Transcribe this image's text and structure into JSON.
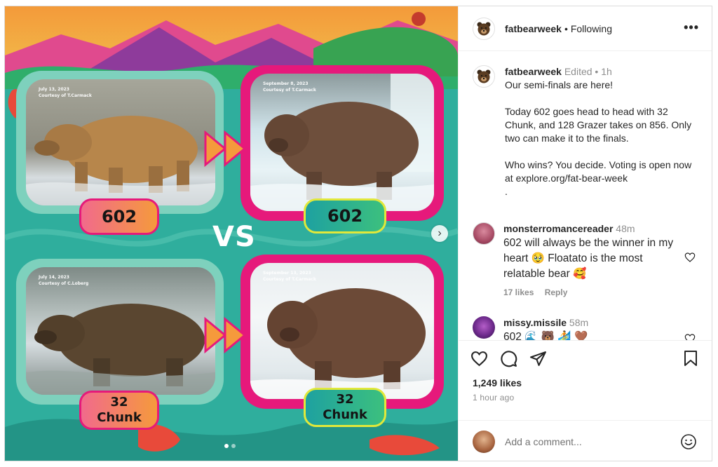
{
  "post": {
    "username": "fatbearweek",
    "follow_status": "Following",
    "more_label": "•••"
  },
  "caption": {
    "username": "fatbearweek",
    "edited": "Edited",
    "time": "1h",
    "lines": [
      "Our semi-finals are here!",
      "",
      "Today 602 goes head to head with 32 Chunk, and 128 Grazer takes on 856. Only two can make it to the finals.",
      "",
      "Who wins? You decide. Voting is open now at explore.org/fat-bear-week",
      "."
    ]
  },
  "comments": [
    {
      "username": "monsterromancereader",
      "time": "48m",
      "text": "602 will always be the winner in my heart 🥹 Floatato is the most relatable bear 🥰",
      "likes": "17 likes",
      "reply": "Reply"
    },
    {
      "username": "missy.missile",
      "time": "58m",
      "text": "602 🌊 🐻 🏄 🤎"
    }
  ],
  "media": {
    "vs_text": "VS",
    "panels": [
      {
        "caption": "July 13, 2023\nCourtesy of T.Carmack",
        "label": "602"
      },
      {
        "caption": "September 8, 2023\nCourtesy of T.Carmack",
        "label": "602"
      },
      {
        "caption": "July 14, 2023\nCourtesy of C.Loberg",
        "label": "32\nChunk"
      },
      {
        "caption": "September 13, 2023\nCourtesy of T.Carmack",
        "label": "32\nChunk"
      }
    ],
    "next_icon": "chevron-right-icon",
    "slide_count": 2
  },
  "stats": {
    "likes": "1,249 likes",
    "time_ago": "1 hour ago"
  },
  "composer": {
    "placeholder": "Add a comment..."
  },
  "colors": {
    "pink_frame": "#e6197b",
    "teal_frame": "#7ed1bd",
    "background_teal": "#2fae9d",
    "accent_orange": "#f59a3c"
  }
}
